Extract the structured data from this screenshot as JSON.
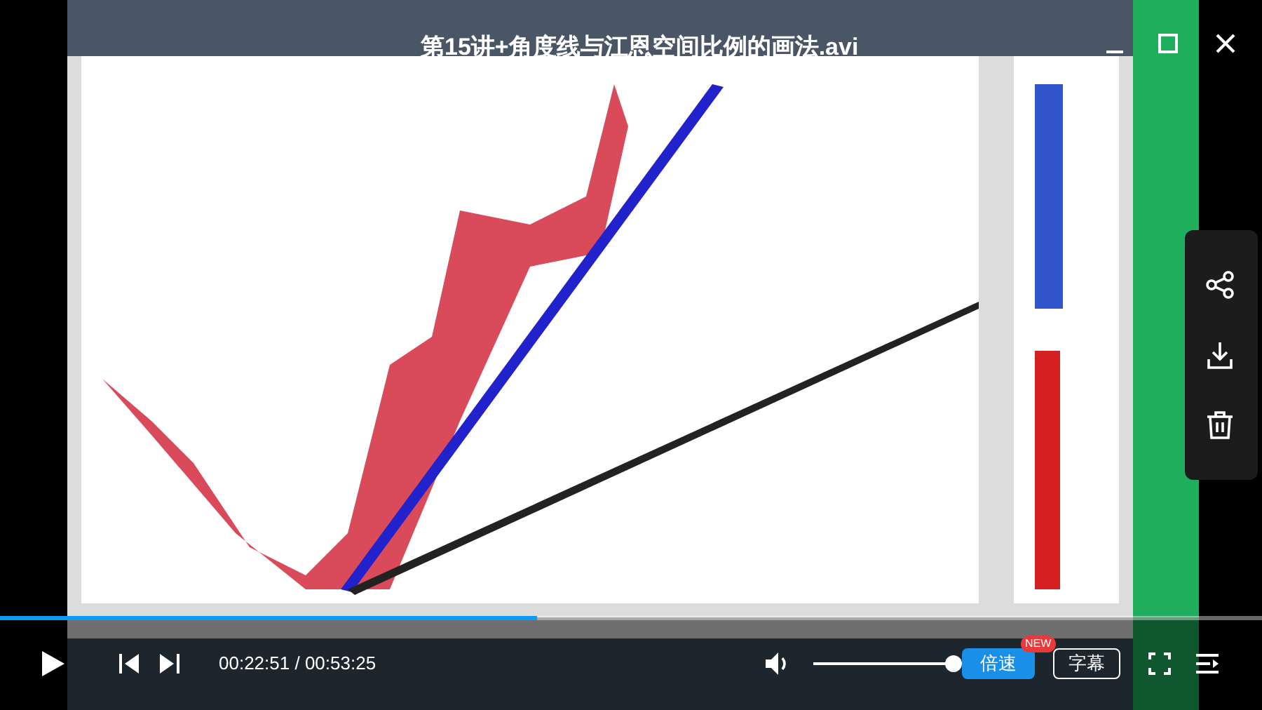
{
  "video": {
    "kind": "picture",
    "title": "第15讲+角度线与江恩空间比例的画法.avi"
  },
  "progress": {
    "level": 0.425
  },
  "time": "00:22:51 / 00:53:25",
  "volume": {
    "level": 1
  },
  "speed_button": {
    "label": "倍速",
    "badge": "NEW"
  },
  "subtitle_button": {
    "label": "字幕"
  }
}
